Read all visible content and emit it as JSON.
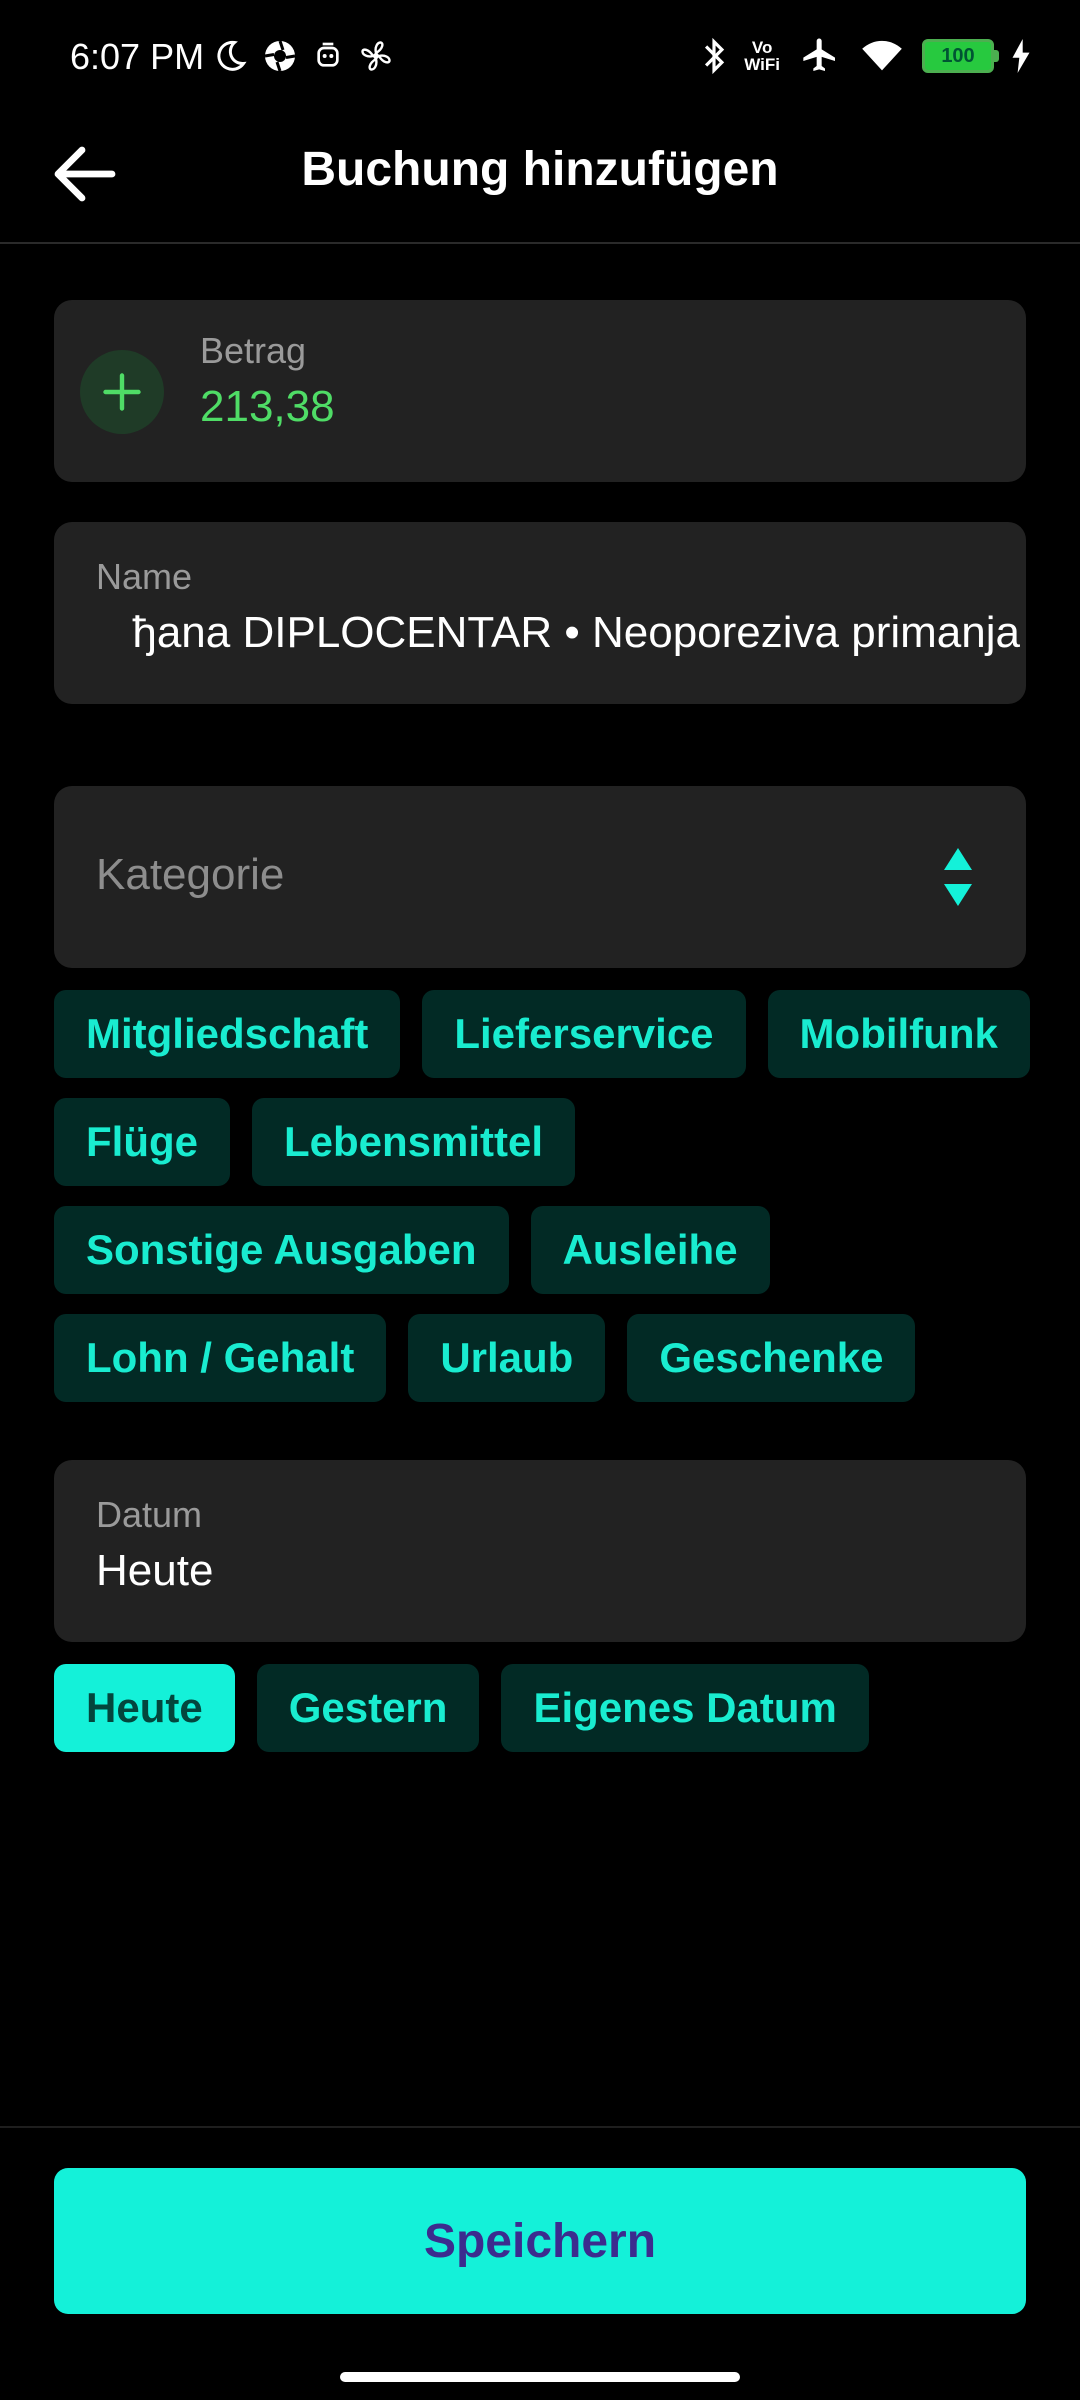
{
  "status": {
    "time": "6:07 PM",
    "battery": "100",
    "vowifi_top": "Vo",
    "vowifi_bottom": "WiFi"
  },
  "header": {
    "title": "Buchung hinzufügen"
  },
  "amount": {
    "label": "Betrag",
    "value": "213,38"
  },
  "name": {
    "label": "Name",
    "value": "ђana DIPLOCENTAR • Neoporeziva primanja"
  },
  "category": {
    "placeholder": "Kategorie",
    "chips": [
      "Mitgliedschaft",
      "Lieferservice",
      "Mobilfunk",
      "Flüge",
      "Lebensmittel",
      "Sonstige Ausgaben",
      "Ausleihe",
      "Lohn / Gehalt",
      "Urlaub",
      "Geschenke"
    ]
  },
  "date": {
    "label": "Datum",
    "value": "Heute",
    "chips": [
      "Heute",
      "Gestern",
      "Eigenes Datum"
    ],
    "selected": "Heute"
  },
  "save_label": "Speichern",
  "colors": {
    "accent": "#14f1d9",
    "amount_green": "#4fdc66",
    "card_bg": "#222222",
    "chip_bg": "#022a25",
    "save_text": "#3c2c8e"
  }
}
